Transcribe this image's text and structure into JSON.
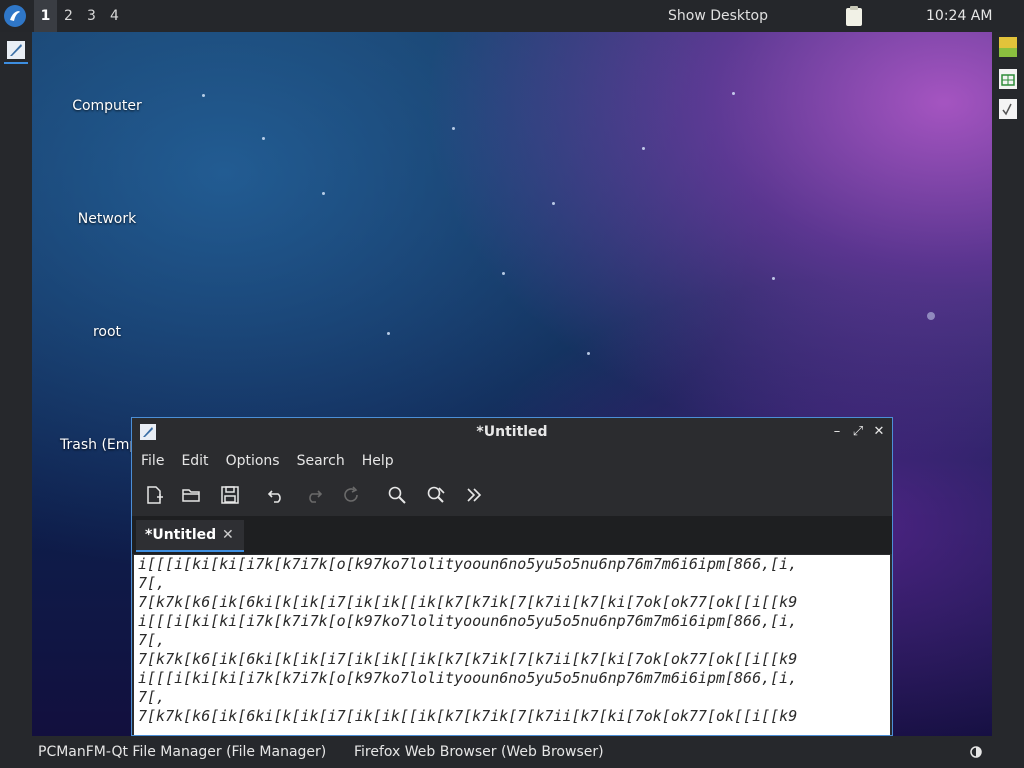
{
  "top_panel": {
    "workspaces": [
      "1",
      "2",
      "3",
      "4"
    ],
    "active_workspace": "1",
    "show_desktop": "Show Desktop",
    "clock": "10:24 AM"
  },
  "desktop": {
    "icons": [
      {
        "label": "Computer"
      },
      {
        "label": "Network"
      },
      {
        "label": "root"
      },
      {
        "label": "Trash (Emp"
      }
    ]
  },
  "window": {
    "title": "*Untitled",
    "controls": {
      "minimize": "–",
      "maximize": "⤢",
      "close": "✕"
    },
    "menu": [
      "File",
      "Edit",
      "Options",
      "Search",
      "Help"
    ],
    "toolbar_icons": [
      "new-document-icon",
      "open-folder-icon",
      "save-icon",
      "undo-icon",
      "redo-icon",
      "reload-icon",
      "search-icon",
      "replace-icon",
      "more-chevrons-icon"
    ],
    "tab": {
      "label": "*Untitled",
      "close": "✕"
    },
    "editor_lines": [
      "i[[[i[ki[ki[i7k[k7i7k[o[k97ko7lolityooun6no5yu5o5nu6np76m7m6i6ipm[866,[i,",
      "7[,",
      "7[k7k[k6[ik[6ki[k[ik[i7[ik[ik[[ik[k7[k7ik[7[k7ii[k7[ki[7ok[ok77[ok[[i[[k9",
      "i[[[i[ki[ki[i7k[k7i7k[o[k97ko7lolityooun6no5yu5o5nu6np76m7m6i6ipm[866,[i,",
      "7[,",
      "7[k7k[k6[ik[6ki[k[ik[i7[ik[ik[[ik[k7[k7ik[7[k7ii[k7[ki[7ok[ok77[ok[[i[[k9",
      "i[[[i[ki[ki[i7k[k7i7k[o[k97ko7lolityooun6no5yu5o5nu6np76m7m6i6ipm[866,[i,",
      "7[,",
      "7[k7k[k6[ik[6ki[k[ik[i7[ik[ik[[ik[k7[k7ik[7[k7ii[k7[ki[7ok[ok77[ok[[i[[k9"
    ]
  },
  "taskbar": {
    "tasks": [
      "PCManFM-Qt File Manager (File Manager)",
      "Firefox Web Browser (Web Browser)"
    ]
  },
  "colors": {
    "accent": "#3d8ee0",
    "panel": "#26282c"
  }
}
